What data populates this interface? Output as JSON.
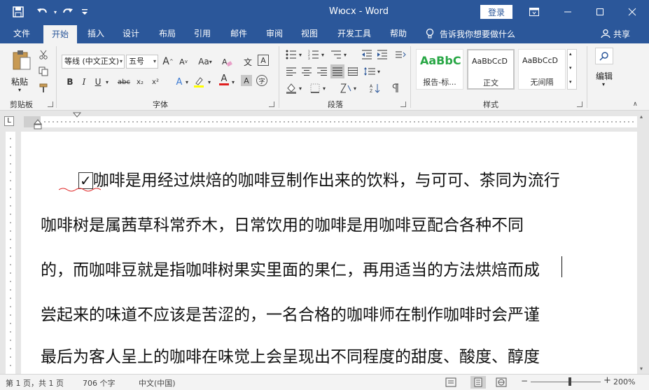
{
  "window": {
    "title": "Wюcx - Word",
    "login_label": "登录",
    "icons": [
      "save-icon",
      "undo-icon",
      "redo-icon",
      "customize-quick-access-icon",
      "ribbon-display-options-icon",
      "minimize-icon",
      "maximize-icon",
      "close-icon"
    ]
  },
  "tabs": [
    "文件",
    "开始",
    "插入",
    "设计",
    "布局",
    "引用",
    "邮件",
    "审阅",
    "视图",
    "开发工具",
    "帮助"
  ],
  "active_tab": "开始",
  "tell_me": "告诉我你想要做什么",
  "share_label": "共享",
  "ribbon": {
    "clipboard": {
      "paste_label": "粘贴",
      "group_label": "剪贴板"
    },
    "font": {
      "font_name": "等线 (中文正文)",
      "font_size": "五号",
      "group_label": "字体",
      "row1_buttons": [
        "A",
        "A",
        "Aa",
        "文",
        "A"
      ],
      "row2_buttons": [
        "B",
        "I",
        "U",
        "abc",
        "x₂",
        "x²"
      ],
      "row3_buttons": [
        "A",
        "A",
        "A",
        "A",
        "字"
      ]
    },
    "paragraph": {
      "group_label": "段落"
    },
    "styles": {
      "group_label": "样式",
      "items": [
        {
          "preview": "AaBbC",
          "name": "报告-标...",
          "color": "#28a745"
        },
        {
          "preview": "AaBbCcD",
          "name": "正文",
          "color": "#222222"
        },
        {
          "preview": "AaBbCcD",
          "name": "无间隔",
          "color": "#222222"
        }
      ]
    },
    "editing": {
      "label": "编辑"
    }
  },
  "ruler": {
    "corner": "L"
  },
  "document": {
    "lines": [
      "咖啡是用经过烘焙的咖啡豆制作出来的饮料，与可可、茶同为流行",
      "咖啡树是属茜草科常乔木，日常饮用的咖啡是用咖啡豆配合各种不同",
      "的，而咖啡豆就是指咖啡树果实里面的果仁，再用适当的方法烘焙而成",
      "尝起来的味道不应该是苦涩的，一名合格的咖啡师在制作咖啡时会严谨",
      "最后为客人呈上的咖啡在味觉上会呈现出不同程度的甜度、酸度、醇度"
    ],
    "checkmark": "✓"
  },
  "status": {
    "page": "第 1 页，共 1 页",
    "words": "706 个字",
    "language": "中文(中国)",
    "zoom": "200%"
  },
  "colors": {
    "accent": "#2b579a",
    "ribbon_bg": "#f3f3f3"
  }
}
